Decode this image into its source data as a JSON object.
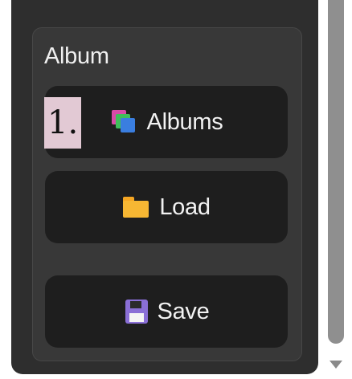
{
  "album_panel": {
    "title": "Album",
    "buttons": [
      {
        "label": "Albums",
        "icon": "albums-icon"
      },
      {
        "label": "Load",
        "icon": "folder-icon"
      },
      {
        "label": "Save",
        "icon": "floppy-disk-icon"
      }
    ]
  },
  "annotation": {
    "marker_label": "1."
  },
  "colors": {
    "panel_background": "#2e2e2e",
    "group_background": "#383838",
    "button_background": "#1e1e1e",
    "text": "#f2f2f2",
    "marker_background": "#e2c9d4"
  }
}
